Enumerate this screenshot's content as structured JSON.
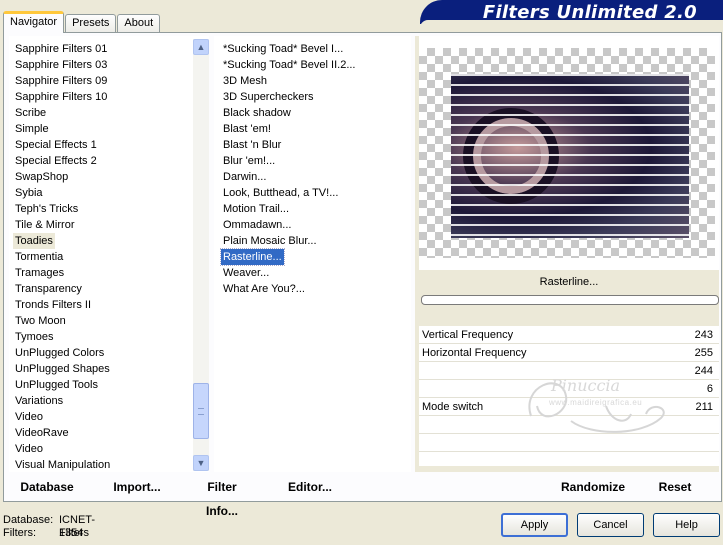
{
  "tabs": [
    {
      "label": "Navigator",
      "active": true
    },
    {
      "label": "Presets",
      "active": false
    },
    {
      "label": "About",
      "active": false
    }
  ],
  "banner": {
    "title": "Filters Unlimited 2.0"
  },
  "categories": {
    "items": [
      "Sapphire Filters 01",
      "Sapphire Filters 03",
      "Sapphire Filters 09",
      "Sapphire Filters 10",
      "Scribe",
      "Simple",
      "Special Effects 1",
      "Special Effects 2",
      "SwapShop",
      "Sybia",
      "Teph's Tricks",
      "Tile & Mirror",
      "Toadies",
      "Tormentia",
      "Tramages",
      "Transparency",
      "Tronds Filters II",
      "Two Moon",
      "Tymoes",
      "UnPlugged Colors",
      "UnPlugged Shapes",
      "UnPlugged Tools",
      "Variations",
      "Video",
      "VideoRave",
      "Video",
      "Visual Manipulation"
    ],
    "selected": "Toadies"
  },
  "filters": {
    "items": [
      "*Sucking Toad*  Bevel I...",
      "*Sucking Toad*  Bevel II.2...",
      "3D Mesh",
      "3D Supercheckers",
      "Black shadow",
      "Blast 'em!",
      "Blast 'n Blur",
      "Blur 'em!...",
      "Darwin...",
      "Look, Butthead, a TV!...",
      "Motion Trail...",
      "Ommadawn...",
      "Plain Mosaic Blur...",
      "Rasterline...",
      "Weaver...",
      "What Are You?..."
    ],
    "selected": "Rasterline..."
  },
  "preview": {
    "filter_name": "Rasterline...",
    "progress": 0
  },
  "parameters": [
    {
      "label": "Vertical Frequency",
      "value": "243"
    },
    {
      "label": "Horizontal Frequency",
      "value": "255"
    },
    {
      "label": "",
      "value": "244"
    },
    {
      "label": "",
      "value": "6"
    },
    {
      "label": "Mode switch",
      "value": "211"
    },
    {
      "label": "",
      "value": ""
    },
    {
      "label": "",
      "value": ""
    },
    {
      "label": "",
      "value": ""
    }
  ],
  "watermark": {
    "signature": "Pinuccia",
    "url": "www.maidireigrafica.eu"
  },
  "footer": {
    "database": "Database",
    "import": "Import...",
    "filter_info": "Filter Info...",
    "editor": "Editor...",
    "randomize": "Randomize",
    "reset": "Reset"
  },
  "status": {
    "database_label": "Database:",
    "database_value": "ICNET-Filters",
    "filters_label": "Filters:",
    "filters_value": "1354"
  },
  "buttons": {
    "apply": "Apply",
    "cancel": "Cancel",
    "help": "Help"
  }
}
